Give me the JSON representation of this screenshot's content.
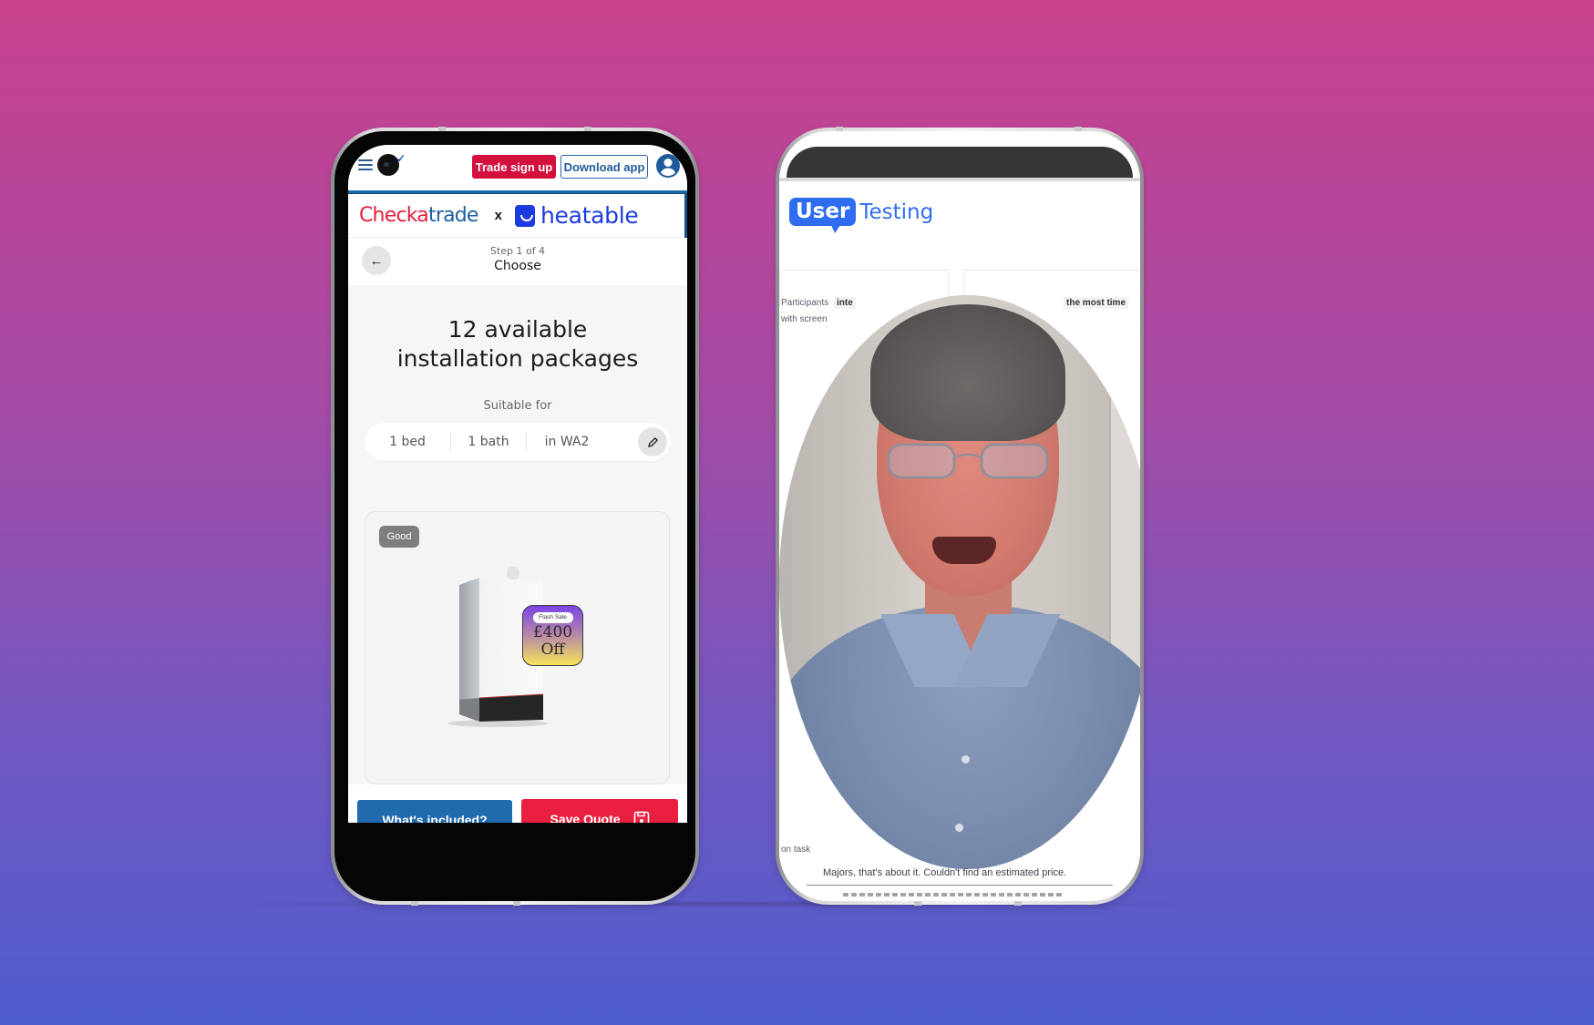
{
  "background": {
    "top_color": "#C8418C",
    "bottom_color": "#4F5DCF"
  },
  "left_phone": {
    "topbar": {
      "menu_icon": "hamburger-icon",
      "trade_signup_label": "Trade sign up",
      "download_app_label": "Download app",
      "account_icon": "user-account-icon"
    },
    "brand": {
      "checkatrade_part1": "Chec",
      "checkatrade_part2": "ka",
      "checkatrade_part3": "trade",
      "separator": "x",
      "heatable": "heatable"
    },
    "step": {
      "label": "Step 1 of 4",
      "title": "Choose",
      "back_icon": "arrow-left-icon"
    },
    "headline_line1": "12 available",
    "headline_line2": "installation packages",
    "suitable_label": "Suitable for",
    "filters": [
      "1 bed",
      "1 bath",
      "in WA2"
    ],
    "edit_icon": "pencil-icon",
    "card": {
      "tier_badge": "Good",
      "flash_label": "Flash Sale",
      "discount_amount": "£400",
      "discount_suffix": "Off"
    },
    "buttons": {
      "whats_included": "What's included?",
      "save_quote": "Save Quote",
      "save_icon": "floppy-disk-icon"
    },
    "colors": {
      "brand_red": "#EA1F40",
      "brand_blue": "#206AAE",
      "heatable_blue": "#1B3BE0"
    }
  },
  "right_phone": {
    "logo_word1": "User",
    "logo_word2": "Testing",
    "bg_text": {
      "participants": "Participants",
      "chip_left": "inte",
      "with_screen": "with screen",
      "chip_right": "the most time",
      "on_task": "on task"
    },
    "caption": "Majors, that's about it. Couldn't find an estimated price.",
    "colors": {
      "brand_blue": "#2F6DF0"
    }
  }
}
